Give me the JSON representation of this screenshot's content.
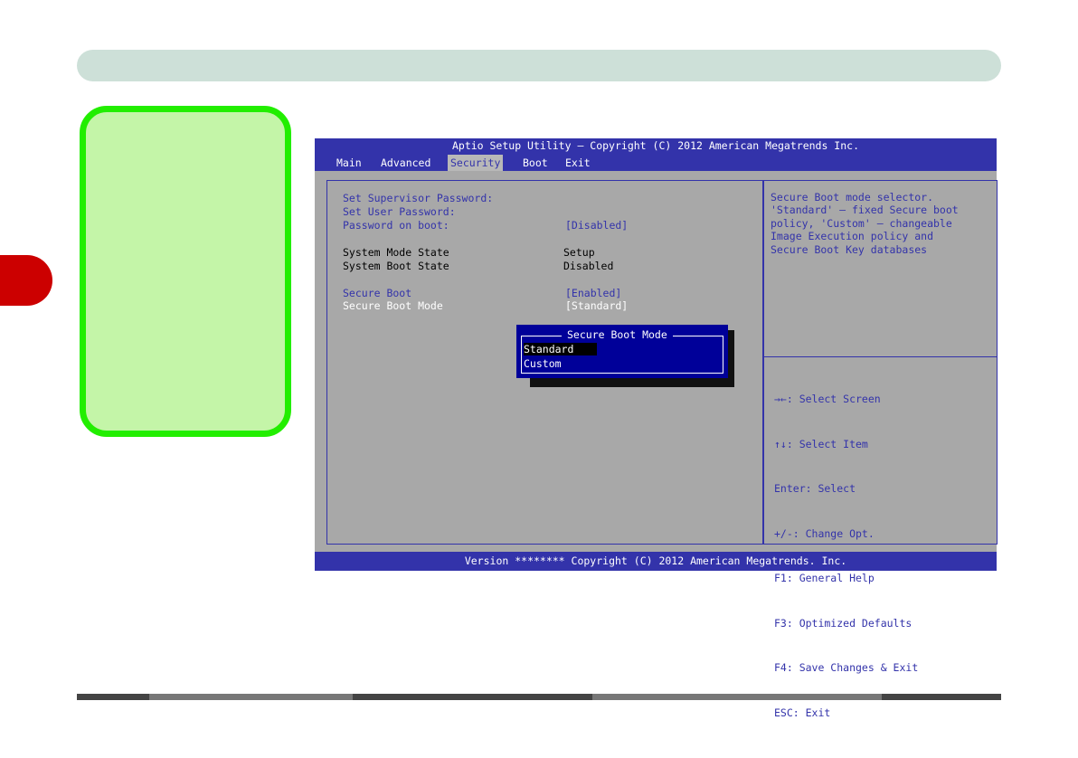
{
  "bios": {
    "title": "Aptio Setup Utility – Copyright (C) 2012 American Megatrends Inc.",
    "tabs": [
      "Main",
      "Advanced",
      "Security",
      "Boot",
      "Exit"
    ],
    "active_tab": "Security",
    "settings": [
      {
        "label": "Set Supervisor Password:",
        "value": ""
      },
      {
        "label": "Set User Password:",
        "value": ""
      },
      {
        "label": "Password on boot:",
        "value": "[Disabled]"
      },
      {
        "label": "System Mode State",
        "value": "Setup"
      },
      {
        "label": "System Boot State",
        "value": "Disabled"
      },
      {
        "label": "Secure Boot",
        "value": "[Enabled]"
      },
      {
        "label": "Secure Boot Mode",
        "value": "[Standard]"
      }
    ],
    "help_text": "Secure Boot mode selector.\n'Standard' – fixed Secure boot\npolicy, 'Custom' – changeable\nImage Execution policy and\nSecure Boot Key databases",
    "keys": [
      "→←: Select Screen",
      "↑↓: Select Item",
      "Enter: Select",
      "+/-: Change Opt.",
      "F1: General Help",
      "F3: Optimized Defaults",
      "F4: Save Changes & Exit",
      "ESC: Exit"
    ],
    "popup": {
      "title": "Secure Boot Mode",
      "options": [
        "Standard",
        "Custom"
      ],
      "selected": "Standard"
    },
    "footer": "Version ******** Copyright (C) 2012 American Megatrends. Inc."
  },
  "colors": {
    "bios_blue": "#3333aa",
    "bios_gray": "#a8a8a8",
    "note_fill": "#c4f5a8",
    "note_border": "#22ee00",
    "side_tab": "#cc0000",
    "header_bar": "#cde0d8"
  }
}
